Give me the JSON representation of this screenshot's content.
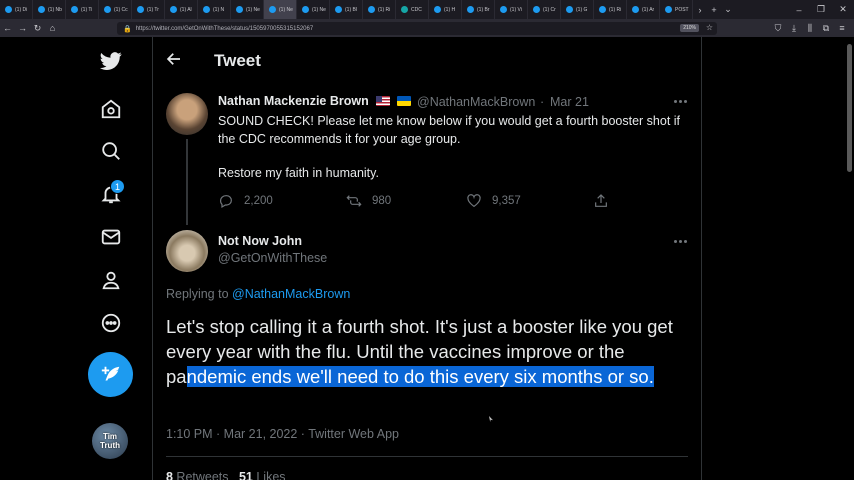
{
  "browser": {
    "tabs": [
      {
        "label": "(1) Di"
      },
      {
        "label": "(1) Nb"
      },
      {
        "label": "(1) Ti"
      },
      {
        "label": "(1) Cc"
      },
      {
        "label": "(1) Tr"
      },
      {
        "label": "(1) Al"
      },
      {
        "label": "(1) N"
      },
      {
        "label": "(1) Ne"
      },
      {
        "label": "(1) Ne"
      },
      {
        "label": "(1) Ne"
      },
      {
        "label": "(1) Bl"
      },
      {
        "label": "(1) Ri"
      },
      {
        "label": "CDC"
      },
      {
        "label": "(1) H"
      },
      {
        "label": "(1) Br"
      },
      {
        "label": "(1) Vi"
      },
      {
        "label": "(1) Cr"
      },
      {
        "label": "(1) G"
      },
      {
        "label": "(1) Ri"
      },
      {
        "label": "(1) Ar"
      },
      {
        "label": "POST"
      }
    ],
    "url": "https://twitter.com/GetOnWithThese/status/1505970055315152067",
    "zoom": "210%"
  },
  "header": {
    "title": "Tweet"
  },
  "sidebar": {
    "notification_count": "1",
    "account_avatar_text": [
      "Tim",
      "Truth"
    ]
  },
  "parent_tweet": {
    "name": "Nathan Mackenzie Brown",
    "handle": "@NathanMackBrown",
    "separator": "·",
    "date": "Mar 21",
    "text_line1": "SOUND CHECK! Please let me know below if you would get a fourth booster shot if the CDC recommends it for your age group.",
    "text_line2": "Restore my faith in humanity.",
    "replies": "2,200",
    "retweets": "980",
    "likes": "9,357"
  },
  "main_tweet": {
    "name": "Not Now John",
    "handle": "@GetOnWithThese",
    "replying_prefix": "Replying to ",
    "replying_to": "@NathanMackBrown",
    "text_plain": "Let's stop calling it a fourth shot. It's just a booster like you get every year with the flu. Until the vaccines improve or the pa",
    "text_highlighted": "ndemic ends we'll need to do this every six months or so.",
    "meta": "1:10 PM · Mar 21, 2022 · Twitter Web App",
    "retweets_count": "8",
    "retweets_label": " Retweets",
    "likes_count": "51",
    "likes_label": " Likes"
  },
  "colors": {
    "accent": "#1d9bf0",
    "text": "#e7e9ea",
    "secondary": "#71767b",
    "highlight": "#0a66d6",
    "background": "#000000"
  }
}
